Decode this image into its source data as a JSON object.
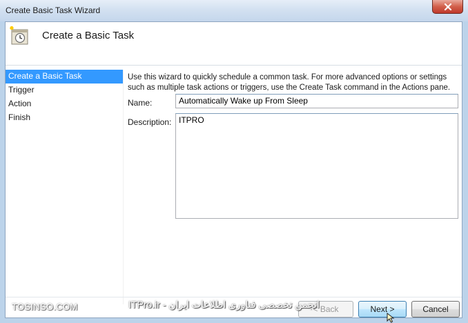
{
  "window": {
    "title": "Create Basic Task Wizard",
    "close_icon": "close-icon"
  },
  "header": {
    "title": "Create a Basic Task",
    "icon": "task-scheduler-icon"
  },
  "nav": {
    "items": [
      {
        "label": "Create a Basic Task",
        "active": true
      },
      {
        "label": "Trigger",
        "active": false
      },
      {
        "label": "Action",
        "active": false
      },
      {
        "label": "Finish",
        "active": false
      }
    ]
  },
  "content": {
    "intro_line1": "Use this wizard to quickly schedule a common task.  For more advanced options or settings",
    "intro_line2": "such as multiple task actions or triggers, use the Create Task command in the Actions pane.",
    "name_label": "Name:",
    "name_value": "Automatically Wake up From Sleep",
    "description_label": "Description:",
    "description_value": "ITPRO"
  },
  "buttons": {
    "back": "< Back",
    "next": "Next >",
    "cancel": "Cancel"
  },
  "watermarks": {
    "left": "TOSINSO.COM",
    "center": "ITPro.ir - انجمن تخصصی فناوری اطلاعات ایران"
  },
  "colors": {
    "selection": "#3399ff",
    "close_button": "#c0392b"
  }
}
